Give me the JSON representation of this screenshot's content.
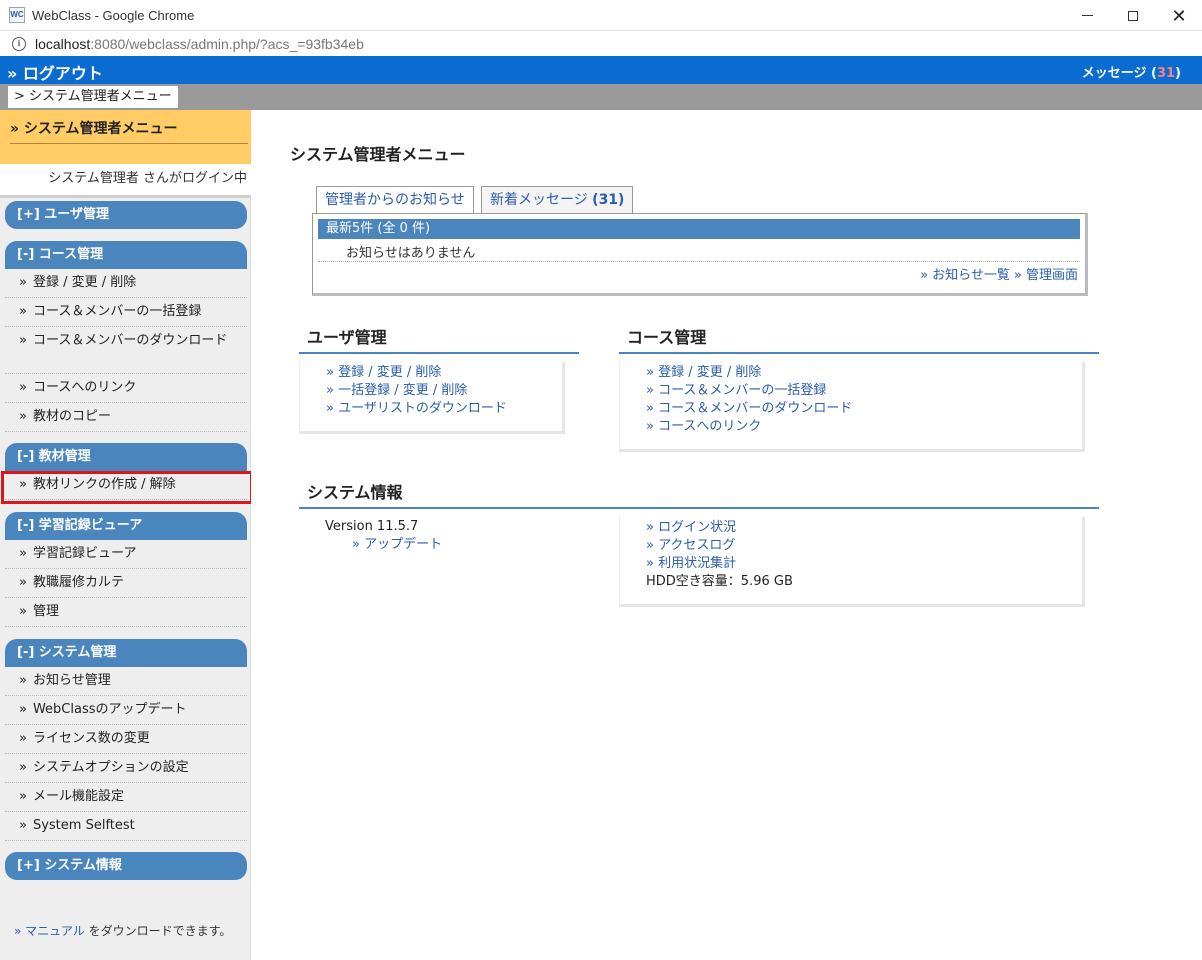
{
  "browser": {
    "window_title": "WebClass - Google Chrome",
    "favicon_text": "WC",
    "url_host": "localhost",
    "url_rest": ":8080/webclass/admin.php/?acs_=93fb34eb",
    "close_glyph": "✕"
  },
  "header": {
    "logout_label": "» ログアウト",
    "messages_label": "メッセージ (",
    "messages_count": "31",
    "messages_suffix": ")"
  },
  "breadcrumb": {
    "current": "> システム管理者メニュー"
  },
  "sidebar": {
    "title": "» システム管理者メニュー",
    "login_status": "システム管理者 さんがログイン中",
    "sections": {
      "user": {
        "head": "[+] ユーザ管理"
      },
      "course": {
        "head": "[-] コース管理",
        "items": [
          "登録 / 変更 / 削除",
          "コース＆メンバーの一括登録",
          "コース＆メンバーのダウンロード",
          "コースへのリンク",
          "教材のコピー"
        ]
      },
      "material": {
        "head": "[-] 教材管理",
        "items": [
          "教材リンクの作成 / 解除"
        ]
      },
      "record": {
        "head": "[-] 学習記録ビューア",
        "items": [
          "学習記録ビューア",
          "教職履修カルテ",
          "管理"
        ]
      },
      "system": {
        "head": "[-] システム管理",
        "items": [
          "お知らせ管理",
          "WebClassのアップデート",
          "ライセンス数の変更",
          "システムオプションの設定",
          "メール機能設定",
          "System Selftest"
        ]
      },
      "sysinfo": {
        "head": "[+] システム情報"
      }
    },
    "bullet": "»",
    "manual_link": "» マニュアル",
    "manual_text": " をダウンロードできます。"
  },
  "main": {
    "title": "システム管理者メニュー",
    "tabs": {
      "notice": "管理者からのお知らせ",
      "messages": "新着メッセージ ",
      "messages_count": "(31)"
    },
    "notice": {
      "head": "最新5件 (全 0 件)",
      "empty": "お知らせはありません",
      "link_list": "» お知らせ一覧",
      "link_admin": "» 管理画面"
    },
    "user_mgmt": {
      "title": "ユーザ管理",
      "links": [
        "» 登録 / 変更 / 削除",
        "» 一括登録 / 変更 / 削除",
        "» ユーザリストのダウンロード"
      ]
    },
    "course_mgmt": {
      "title": "コース管理",
      "links": [
        "» 登録 / 変更 / 削除",
        "» コース＆メンバーの一括登録",
        "» コース＆メンバーのダウンロード",
        "» コースへのリンク"
      ]
    },
    "system_info": {
      "title": "システム情報",
      "version": "Version 11.5.7",
      "update_link": "» アップデート",
      "links": [
        "» ログイン状況",
        "» アクセスログ",
        "» 利用状況集計"
      ],
      "hdd": "HDD空き容量：5.96 GB"
    }
  },
  "colors": {
    "app_header": "#0a6bd0",
    "section_head": "#4a86bd",
    "sidebar_top": "#ffcc66",
    "link": "#2a5db0",
    "highlight": "#e0141e"
  }
}
